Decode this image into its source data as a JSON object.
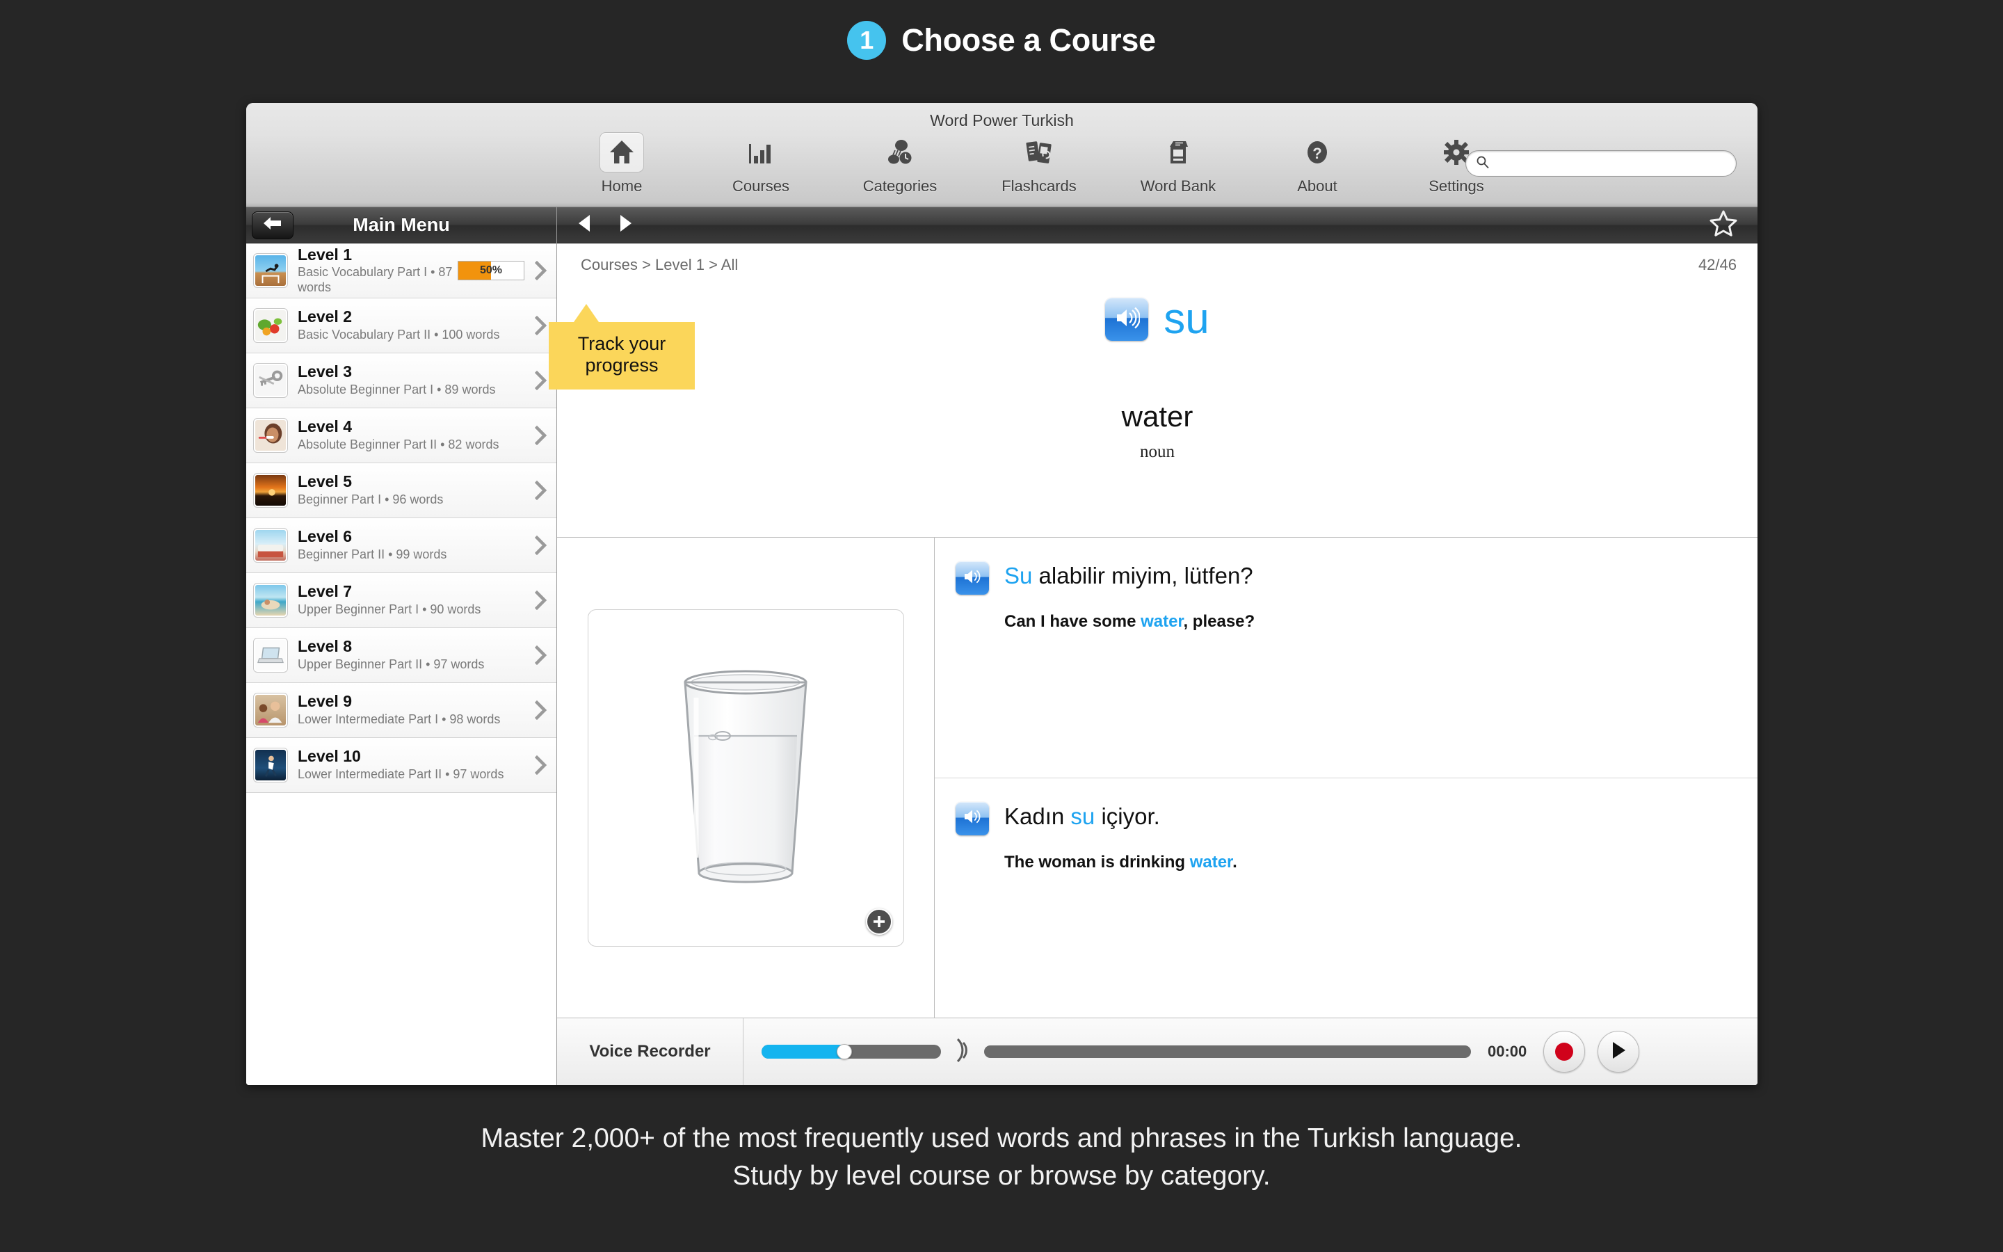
{
  "headline": {
    "step": "1",
    "title": "Choose a Course"
  },
  "accent_colors": {
    "step_badge": "#45c3ee",
    "word_blue": "#1ea3f0",
    "progress_orange": "#f2930d",
    "callout_yellow": "#fbd65a",
    "record_red": "#d0021b",
    "volume_blue": "#14b4ef"
  },
  "window": {
    "title": "Word Power Turkish",
    "toolbar": {
      "items": [
        {
          "label": "Home",
          "icon": "home-icon",
          "active": true
        },
        {
          "label": "Courses",
          "icon": "bar-chart-icon",
          "active": false
        },
        {
          "label": "Categories",
          "icon": "categories-icon",
          "active": false
        },
        {
          "label": "Flashcards",
          "icon": "flashcards-icon",
          "active": false
        },
        {
          "label": "Word Bank",
          "icon": "word-bank-icon",
          "active": false
        },
        {
          "label": "About",
          "icon": "question-mark-icon",
          "active": false
        },
        {
          "label": "Settings",
          "icon": "gear-icon",
          "active": false
        }
      ],
      "search": {
        "value": "",
        "placeholder": ""
      }
    }
  },
  "sidebar": {
    "title": "Main Menu",
    "back_label": "Back",
    "levels": [
      {
        "title": "Level 1",
        "subtitle": "Basic Vocabulary Part I • 87 words",
        "progress": "50%",
        "progress_value": 50,
        "thumb": "hurdler-photo"
      },
      {
        "title": "Level 2",
        "subtitle": "Basic Vocabulary Part II • 100 words",
        "progress": "",
        "progress_value": null,
        "thumb": "vegetables-photo"
      },
      {
        "title": "Level 3",
        "subtitle": "Absolute Beginner Part I • 89 words",
        "progress": "",
        "progress_value": null,
        "thumb": "keys-photo"
      },
      {
        "title": "Level 4",
        "subtitle": "Absolute Beginner Part II • 82 words",
        "progress": "",
        "progress_value": null,
        "thumb": "toothbrush-photo"
      },
      {
        "title": "Level 5",
        "subtitle": "Beginner Part I • 96 words",
        "progress": "",
        "progress_value": null,
        "thumb": "sunset-photo"
      },
      {
        "title": "Level 6",
        "subtitle": "Beginner Part II • 99 words",
        "progress": "",
        "progress_value": null,
        "thumb": "bed-photo"
      },
      {
        "title": "Level 7",
        "subtitle": "Upper Beginner Part I • 90 words",
        "progress": "",
        "progress_value": null,
        "thumb": "hammock-beach-photo"
      },
      {
        "title": "Level 8",
        "subtitle": "Upper Beginner Part II • 97 words",
        "progress": "",
        "progress_value": null,
        "thumb": "laptop-photo"
      },
      {
        "title": "Level 9",
        "subtitle": "Lower Intermediate Part I • 98 words",
        "progress": "",
        "progress_value": null,
        "thumb": "teacher-photo"
      },
      {
        "title": "Level 10",
        "subtitle": "Lower Intermediate Part II • 97 words",
        "progress": "",
        "progress_value": null,
        "thumb": "runner-photo"
      }
    ]
  },
  "callout": {
    "text": "Track your progress"
  },
  "main": {
    "breadcrumb": "Courses > Level 1 > All",
    "counter": "42/46",
    "favorite_state": "off",
    "word": {
      "target": "su",
      "translation": "water",
      "part_of_speech": "noun"
    },
    "image_caption": "glass-of-water-photo",
    "examples": [
      {
        "target_pre": "",
        "target_hl": "Su",
        "target_post": " alabilir miyim, lütfen?",
        "en_pre": "Can I have some ",
        "en_hl": "water",
        "en_post": ", please?"
      },
      {
        "target_pre": "Kadın ",
        "target_hl": "su",
        "target_post": " içiyor.",
        "en_pre": "The woman is drinking ",
        "en_hl": "water",
        "en_post": "."
      }
    ],
    "recorder": {
      "label": "Voice Recorder",
      "time": "00:00",
      "volume_percent": 46,
      "record_button": "record",
      "play_button": "play"
    }
  },
  "footer": {
    "line1": "Master 2,000+ of the most frequently used words and phrases in the Turkish language.",
    "line2": "Study by level course or browse by category."
  }
}
